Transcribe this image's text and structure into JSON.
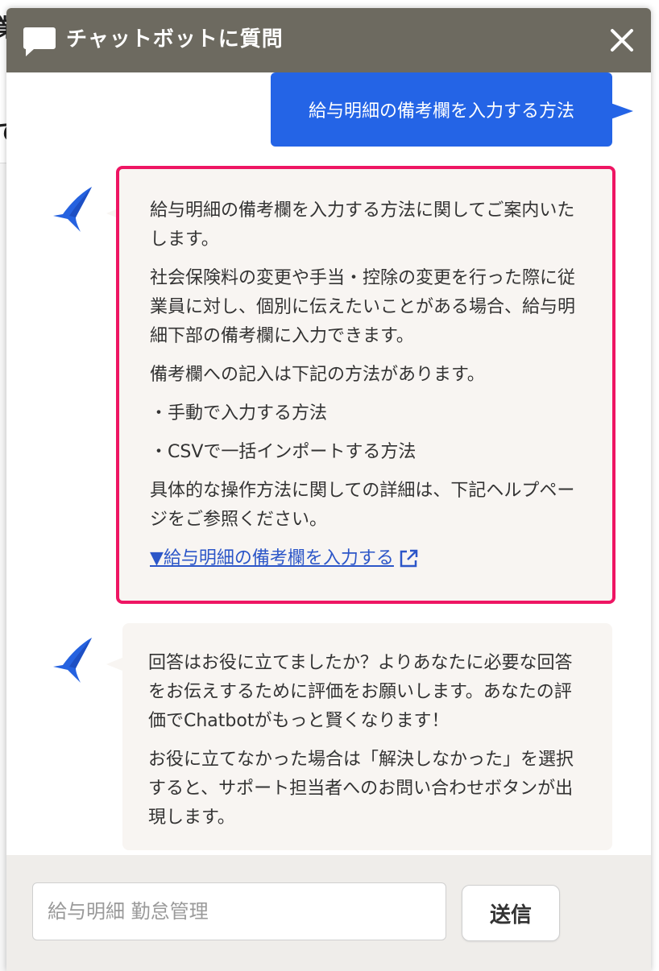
{
  "header": {
    "title": "チャットボットに質問",
    "chat_icon": "chat-bubble-icon",
    "close_icon": "close-icon"
  },
  "background": {
    "glyph_1": "業",
    "glyph_2": "て"
  },
  "conversation": {
    "user_message": "給与明細の備考欄を入力する方法",
    "bot_reply": {
      "p1": "給与明細の備考欄を入力する方法に関してご案内いたします。",
      "p2": "社会保険料の変更や手当・控除の変更を行った際に従業員に対し、個別に伝えたいことがある場合、給与明細下部の備考欄に入力できます。",
      "p3": "備考欄への記入は下記の方法があります。",
      "p4": "・手動で入力する方法",
      "p5": "・CSVで一括インポートする方法",
      "p6": "具体的な操作方法に関しての詳細は、下記ヘルプページをご参照ください。",
      "link_text": "▼給与明細の備考欄を入力する",
      "link_icon": "external-link-icon"
    },
    "bot_feedback": {
      "p1": "回答はお役に立てましたか？よりあなたに必要な回答をお伝えするために評価をお願いします。あなたの評価でChatbotがもっと賢くなります！",
      "p2": "お役に立てなかった場合は「解決しなかった」を選択すると、サポート担当者へのお問い合わせボタンが出現します。"
    },
    "bot_avatar_icon": "swallow-bird-icon"
  },
  "footer": {
    "input_placeholder": "給与明細 勤怠管理",
    "input_value": "",
    "send_label": "送信"
  },
  "colors": {
    "header_bg": "#6d6a60",
    "user_bubble": "#2464e6",
    "highlight_border": "#ee1563",
    "bot_bubble": "#f8f5f2",
    "link": "#2c56c8",
    "footer_bg": "#efedea"
  }
}
